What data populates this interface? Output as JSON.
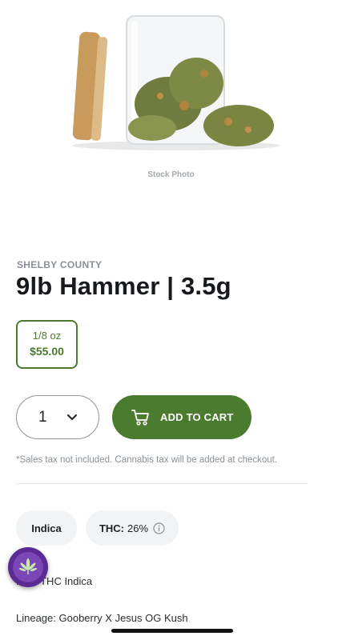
{
  "product": {
    "image_caption": "Stock Photo",
    "brand": "SHELBY COUNTY",
    "title": "9lb Hammer | 3.5g",
    "weight_option": {
      "label": "1/8 oz",
      "price": "$55.00"
    },
    "quantity": "1",
    "add_to_cart_label": "ADD TO CART",
    "tax_note": "*Sales tax not included. Cannabis tax will be added at checkout.",
    "tags": {
      "strain_type": "Indica",
      "thc_label": "THC:",
      "thc_value": "26%"
    },
    "description": "High THC Indica",
    "lineage": "Lineage: Gooberry X Jesus OG Kush"
  },
  "colors": {
    "accent": "#4a7b2e",
    "fab": "#5b2a93"
  },
  "icons": [
    "cart-icon",
    "chevron-down-icon",
    "info-icon",
    "cannabis-leaf-icon"
  ]
}
